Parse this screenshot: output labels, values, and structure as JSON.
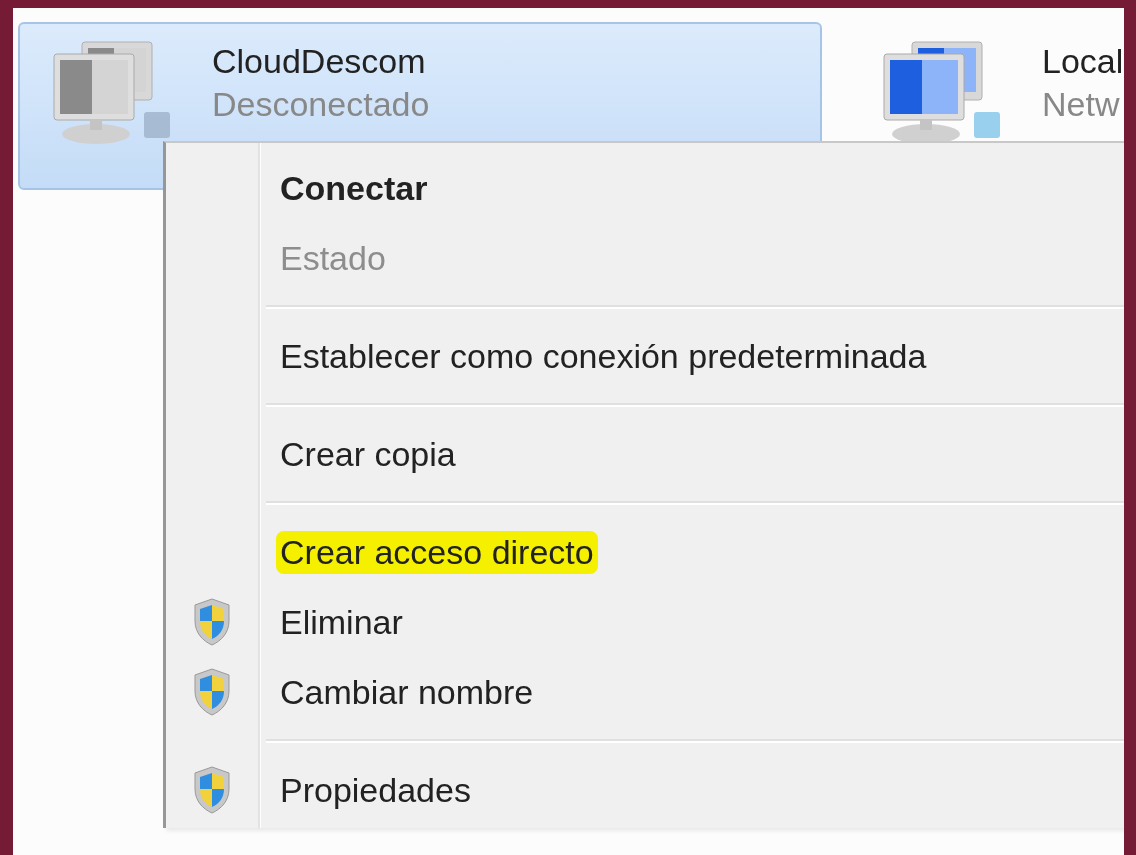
{
  "connections": [
    {
      "name": "CloudDescom",
      "status": "Desconectado",
      "selected": true,
      "connected": false
    },
    {
      "name": "Local",
      "status": "Netw",
      "selected": false,
      "connected": true
    }
  ],
  "context_menu": {
    "items": [
      {
        "kind": "item",
        "label": "Conectar",
        "default": true,
        "disabled": false,
        "shield": false,
        "highlighted": false
      },
      {
        "kind": "item",
        "label": "Estado",
        "default": false,
        "disabled": true,
        "shield": false,
        "highlighted": false
      },
      {
        "kind": "separator"
      },
      {
        "kind": "item",
        "label": "Establecer como conexión predeterminada",
        "default": false,
        "disabled": false,
        "shield": false,
        "highlighted": false
      },
      {
        "kind": "separator"
      },
      {
        "kind": "item",
        "label": "Crear copia",
        "default": false,
        "disabled": false,
        "shield": false,
        "highlighted": false
      },
      {
        "kind": "separator"
      },
      {
        "kind": "item",
        "label": "Crear acceso directo",
        "default": false,
        "disabled": false,
        "shield": false,
        "highlighted": true
      },
      {
        "kind": "item",
        "label": "Eliminar",
        "default": false,
        "disabled": false,
        "shield": true,
        "highlighted": false
      },
      {
        "kind": "item",
        "label": "Cambiar nombre",
        "default": false,
        "disabled": false,
        "shield": true,
        "highlighted": false
      },
      {
        "kind": "separator"
      },
      {
        "kind": "item",
        "label": "Propiedades",
        "default": false,
        "disabled": false,
        "shield": true,
        "highlighted": false
      }
    ]
  }
}
